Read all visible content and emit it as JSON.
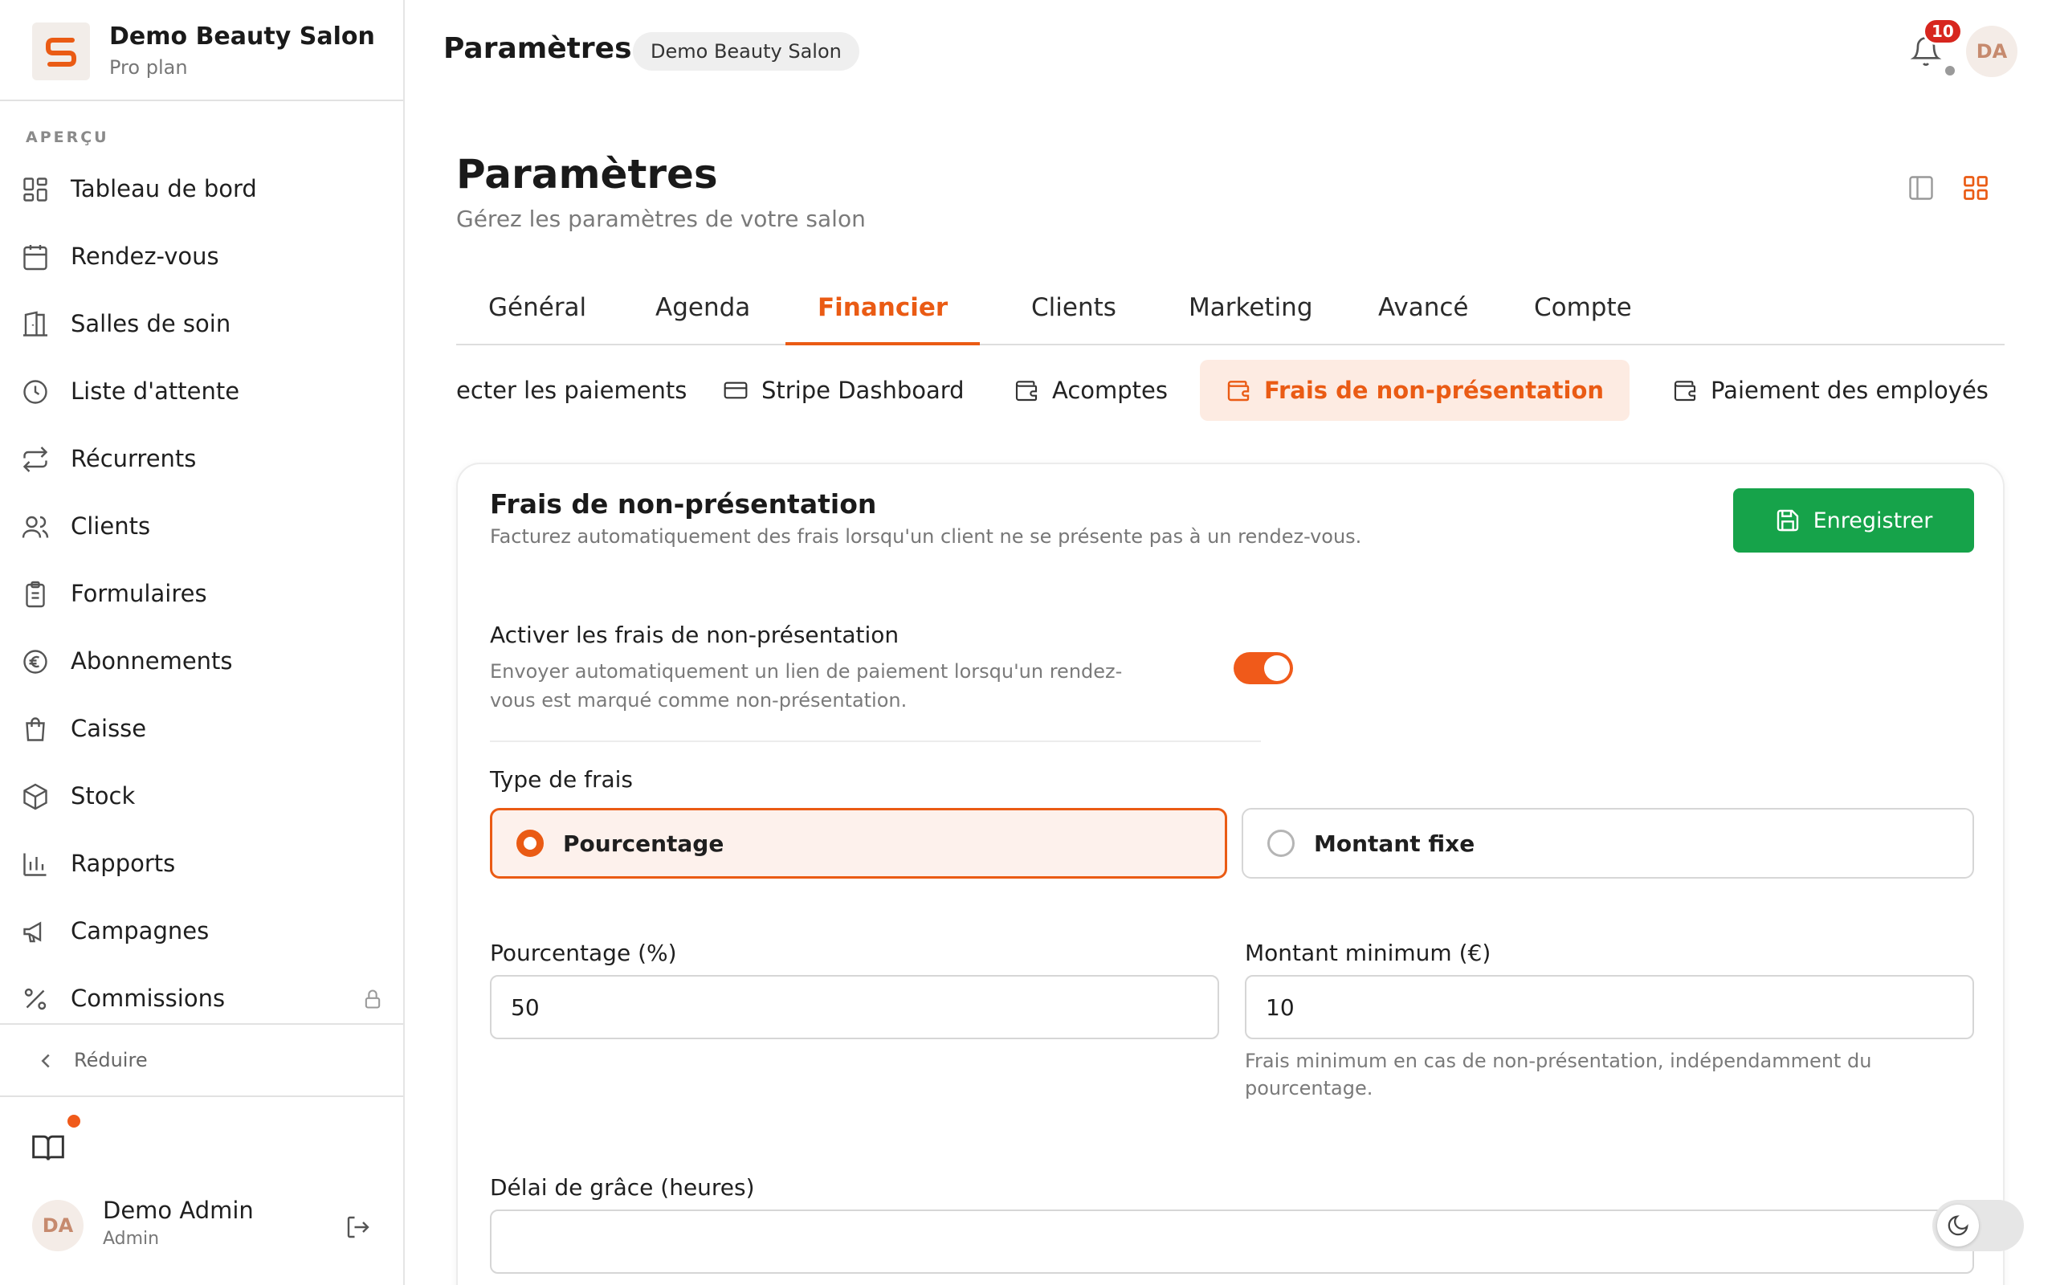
{
  "brand": {
    "name": "Demo Beauty Salon",
    "plan": "Pro plan",
    "logo_letter": "S",
    "accent": "#ea5b14"
  },
  "sidebar": {
    "section": "APERÇU",
    "items": [
      {
        "label": "Tableau de bord",
        "icon": "dashboard-icon"
      },
      {
        "label": "Rendez-vous",
        "icon": "calendar-icon"
      },
      {
        "label": "Salles de soin",
        "icon": "door-icon"
      },
      {
        "label": "Liste d'attente",
        "icon": "clock-icon"
      },
      {
        "label": "Récurrents",
        "icon": "repeat-icon"
      },
      {
        "label": "Clients",
        "icon": "users-icon"
      },
      {
        "label": "Formulaires",
        "icon": "clipboard-icon"
      },
      {
        "label": "Abonnements",
        "icon": "euro-icon"
      },
      {
        "label": "Caisse",
        "icon": "shopping-bag-icon"
      },
      {
        "label": "Stock",
        "icon": "package-icon"
      },
      {
        "label": "Rapports",
        "icon": "bar-chart-icon"
      },
      {
        "label": "Campagnes",
        "icon": "megaphone-icon"
      },
      {
        "label": "Commissions",
        "icon": "percent-icon"
      }
    ],
    "reduce_label": "Réduire"
  },
  "user": {
    "initials": "DA",
    "name": "Demo Admin",
    "role": "Admin"
  },
  "header": {
    "title": "Paramètres",
    "badge": "Demo Beauty Salon",
    "notifications": "10",
    "avatar_initials": "DA"
  },
  "page": {
    "title": "Paramètres",
    "subtitle": "Gérez les paramètres de votre salon"
  },
  "tabs": [
    {
      "label": "Général"
    },
    {
      "label": "Agenda"
    },
    {
      "label": "Financier",
      "active": true
    },
    {
      "label": "Clients"
    },
    {
      "label": "Marketing"
    },
    {
      "label": "Avancé"
    },
    {
      "label": "Compte"
    }
  ],
  "subtabs": [
    {
      "label": "ecter les paiements"
    },
    {
      "label": "Stripe Dashboard"
    },
    {
      "label": "Acomptes"
    },
    {
      "label": "Frais de non-présentation",
      "active": true
    },
    {
      "label": "Paiement des employés",
      "locked": true
    }
  ],
  "card": {
    "title": "Frais de non-présentation",
    "description": "Facturez automatiquement des frais lorsqu'un client ne se présente pas à un rendez-vous.",
    "save_label": "Enregistrer",
    "toggle": {
      "title": "Activer les frais de non-présentation",
      "description": "Envoyer automatiquement un lien de paiement lorsqu'un rendez-vous est marqué comme non-présentation.",
      "enabled": true
    },
    "fee_type": {
      "label": "Type de frais",
      "options": [
        {
          "label": "Pourcentage",
          "selected": true
        },
        {
          "label": "Montant fixe",
          "selected": false
        }
      ]
    },
    "percentage": {
      "label": "Pourcentage (%)",
      "value": "50"
    },
    "minimum": {
      "label": "Montant minimum (€)",
      "value": "10",
      "help": "Frais minimum en cas de non-présentation, indépendamment du pourcentage."
    },
    "grace": {
      "label": "Délai de grâce (heures)",
      "value": ""
    }
  }
}
